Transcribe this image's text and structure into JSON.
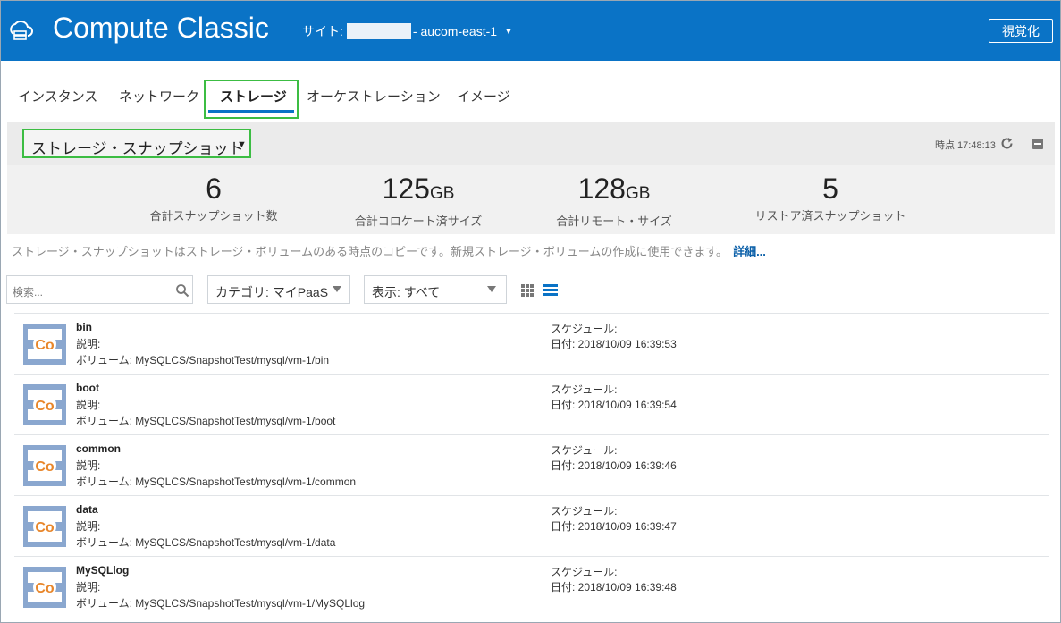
{
  "header": {
    "title": "Compute Classic",
    "site_prefix": "サイト:",
    "site_suffix": "- aucom-east-1",
    "visualize_label": "視覚化",
    "brand_color": "#0a73c6"
  },
  "tabs": [
    {
      "label": "インスタンス",
      "active": false
    },
    {
      "label": "ネットワーク",
      "active": false
    },
    {
      "label": "ストレージ",
      "active": true
    },
    {
      "label": "オーケストレーション",
      "active": false
    },
    {
      "label": "イメージ",
      "active": false
    }
  ],
  "panel": {
    "selector_label": "ストレージ・スナップショット",
    "timepoint": "時点 17:48:13",
    "metrics": [
      {
        "value": "6",
        "unit": "",
        "label": "合計スナップショット数"
      },
      {
        "value": "125",
        "unit": "GB",
        "label": "合計コロケート済サイズ"
      },
      {
        "value": "128",
        "unit": "GB",
        "label": "合計リモート・サイズ"
      },
      {
        "value": "5",
        "unit": "",
        "label": "リストア済スナップショット"
      }
    ]
  },
  "description": {
    "text": "ストレージ・スナップショットはストレージ・ボリュームのある時点のコピーです。新規ストレージ・ボリュームの作成に使用できます。",
    "more_link": "詳細..."
  },
  "filters": {
    "search_placeholder": "検索...",
    "category": "カテゴリ: マイPaaS",
    "display": "表示: すべて"
  },
  "snapshots": [
    {
      "name": "bin",
      "desc_label": "説明:",
      "volume": "ボリューム: MySQLCS/SnapshotTest/mysql/vm-1/bin",
      "schedule_label": "スケジュール:",
      "date": "日付: 2018/10/09 16:39:53"
    },
    {
      "name": "boot",
      "desc_label": "説明:",
      "volume": "ボリューム: MySQLCS/SnapshotTest/mysql/vm-1/boot",
      "schedule_label": "スケジュール:",
      "date": "日付: 2018/10/09 16:39:54"
    },
    {
      "name": "common",
      "desc_label": "説明:",
      "volume": "ボリューム: MySQLCS/SnapshotTest/mysql/vm-1/common",
      "schedule_label": "スケジュール:",
      "date": "日付: 2018/10/09 16:39:46"
    },
    {
      "name": "data",
      "desc_label": "説明:",
      "volume": "ボリューム: MySQLCS/SnapshotTest/mysql/vm-1/data",
      "schedule_label": "スケジュール:",
      "date": "日付: 2018/10/09 16:39:47"
    },
    {
      "name": "MySQLlog",
      "desc_label": "説明:",
      "volume": "ボリューム: MySQLCS/SnapshotTest/mysql/vm-1/MySQLlog",
      "schedule_label": "スケジュール:",
      "date": "日付: 2018/10/09 16:39:48"
    }
  ],
  "icon_text": "Co"
}
